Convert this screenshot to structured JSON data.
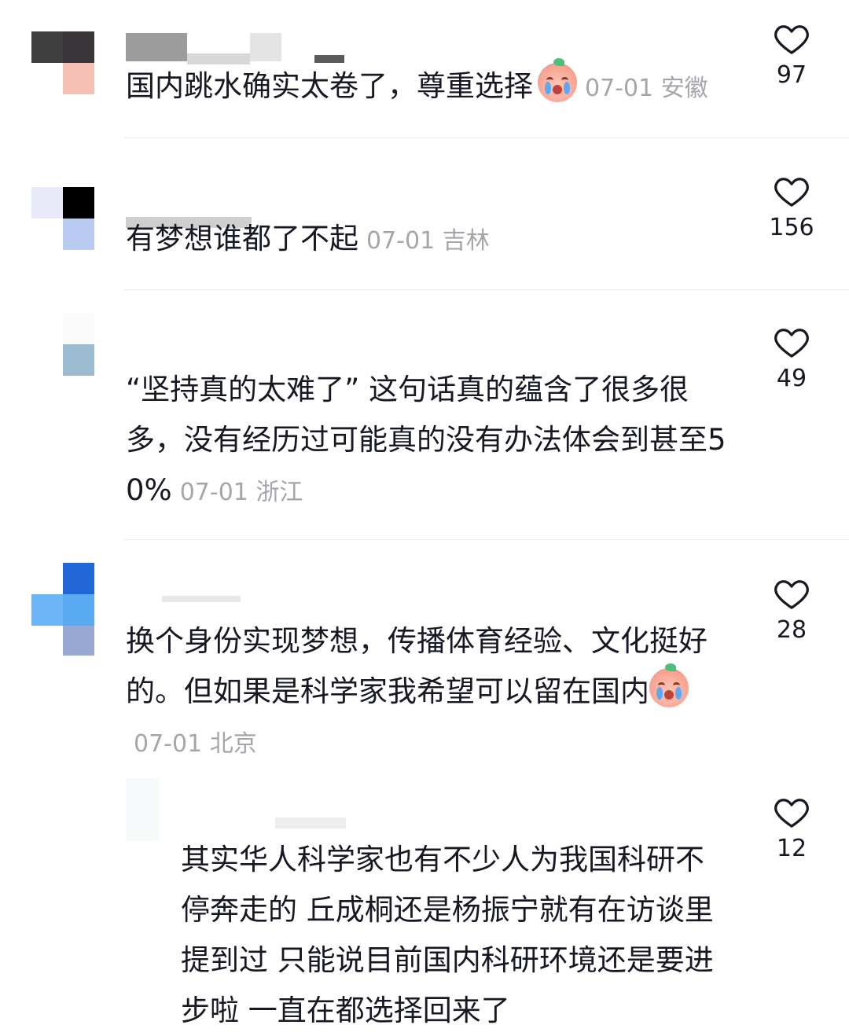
{
  "colors": {
    "text": "#161823",
    "meta": "#a5a6ab",
    "divider": "#ececee"
  },
  "comments": [
    {
      "text": "国内跳水确实太卷了，尊重选择",
      "emoji": "crying-emoji",
      "date": "07-01",
      "location": "安徽",
      "likes": "97"
    },
    {
      "text": "有梦想谁都了不起",
      "date": "07-01",
      "location": "吉林",
      "likes": "156"
    },
    {
      "text": "“坚持真的太难了” 这句话真的蕴含了很多很多，没有经历过可能真的没有办法体会到甚至50%",
      "date": "07-01",
      "location": "浙江",
      "likes": "49"
    },
    {
      "text": "换个身份实现梦想，传播体育经验、文化挺好的。但如果是科学家我希望可以留在国内",
      "emoji": "crying-emoji",
      "date": "07-01",
      "location": "北京",
      "likes": "28"
    }
  ],
  "reply": {
    "text": "其实华人科学家也有不少人为我国科研不停奔走的 丘成桐还是杨振宁就有在访谈里提到过 只能说目前国内科研环境还是要进步啦 一直在都选择回来了",
    "likes": "12"
  }
}
